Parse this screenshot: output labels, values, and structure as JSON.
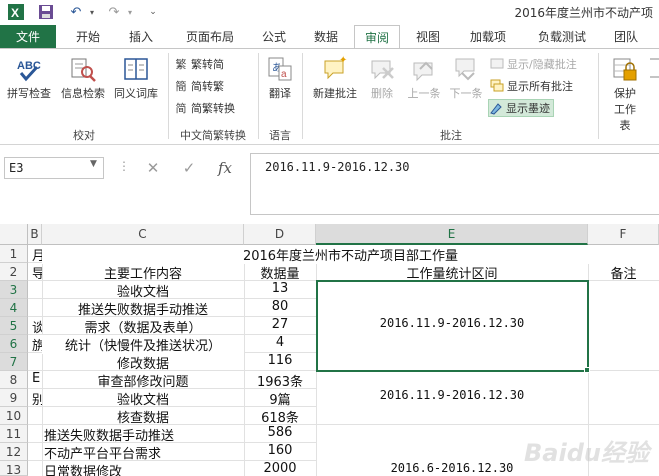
{
  "title_bar": {
    "doc_title": "2016年度兰州市不动产项",
    "qat": [
      "excel-icon",
      "save-icon",
      "undo-icon",
      "redo-icon"
    ]
  },
  "tabs": [
    "文件",
    "开始",
    "插入",
    "页面布局",
    "公式",
    "数据",
    "审阅",
    "视图",
    "加载项",
    "负载测试",
    "团队"
  ],
  "ribbon": {
    "proofing": {
      "spell": "拼写检查",
      "research": "信息检索",
      "thesaurus": "同义词库",
      "label": "校对"
    },
    "chinese": {
      "t2s": "繁转简",
      "s2t": "简转繁",
      "convert": "简繁转换",
      "label": "中文简繁转换"
    },
    "language": {
      "translate": "翻译",
      "label": "语言"
    },
    "comments": {
      "new": "新建批注",
      "delete": "删除",
      "prev": "上一条",
      "next": "下一条",
      "show_hide": "显示/隐藏批注",
      "show_all": "显示所有批注",
      "show_ink": "显示墨迹",
      "label": "批注"
    },
    "protect": {
      "protect_sheet": "保护工作表"
    }
  },
  "formula_bar": {
    "name_box": "E3",
    "formula": "2016.11.9-2016.12.30"
  },
  "grid": {
    "columns": [
      "B",
      "C",
      "D",
      "E",
      "F"
    ],
    "rows": [
      "1",
      "2",
      "3",
      "4",
      "5",
      "6",
      "7",
      "8",
      "9",
      "10",
      "11",
      "12",
      "13"
    ],
    "title": "2016年度兰州市不动产项目部工作量",
    "headers": {
      "c": "主要工作内容",
      "d": "数据量",
      "e": "工作量统计区间",
      "f": "备注"
    },
    "data": [
      {
        "c": "验收文档",
        "d": "13"
      },
      {
        "c": "推送失败数据手动推送",
        "d": "80"
      },
      {
        "c": "需求（数据及表单）",
        "d": "27"
      },
      {
        "c": "统计（快慢件及推送状况）",
        "d": "4"
      },
      {
        "c": "修改数据",
        "d": "116"
      },
      {
        "c": "审查部修改问题",
        "d": "1963条"
      },
      {
        "c": "验收文档",
        "d": "9篇"
      },
      {
        "c": "核查数据",
        "d": "618条"
      },
      {
        "c": "推送失败数据手动推送",
        "d": "586"
      },
      {
        "c": "不动产平台平台需求",
        "d": "160"
      },
      {
        "c": "日常数据修改",
        "d": "2000"
      }
    ],
    "e_values": {
      "e3": "2016.11.9-2016.12.30",
      "e8": "2016.11.9-2016.12.30",
      "e11": "2016.6-2016.12.30"
    },
    "b_fragments": [
      "月",
      "导",
      "谈",
      "旃",
      "E",
      "别"
    ]
  },
  "watermark": "Baidu经验"
}
